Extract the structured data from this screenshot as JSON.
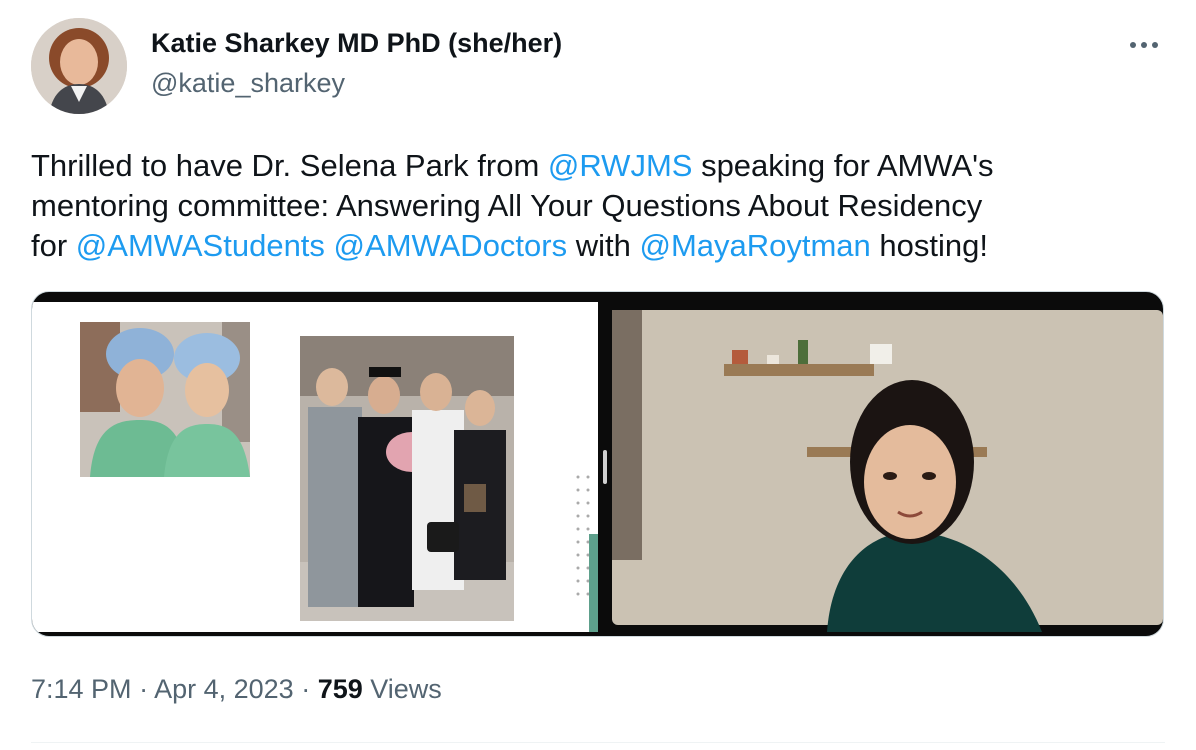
{
  "tweet": {
    "author": {
      "display_name": "Katie Sharkey MD PhD (she/her)",
      "handle": "@katie_sharkey"
    },
    "more_icon": "more-horizontal-icon",
    "text": {
      "line1": {
        "a": "Thrilled to have Dr. Selena Park from ",
        "mention1": "@RWJMS",
        "b": " speaking for AMWA's"
      },
      "line2": "mentoring committee: Answering All Your Questions About Residency",
      "line3": {
        "a": "for ",
        "mention1": "@AMWAStudents",
        "space": " ",
        "mention2": "@AMWADoctors",
        "b": " with ",
        "mention3": "@MayaRoytman",
        "c": " hosting!"
      }
    },
    "time": "7:14 PM",
    "separator": " · ",
    "date": "Apr 4, 2023",
    "views_count": "759",
    "views_label": " Views"
  },
  "colors": {
    "mention": "#1d9bf0",
    "secondary_text": "#536471",
    "primary_text": "#0f1419"
  }
}
